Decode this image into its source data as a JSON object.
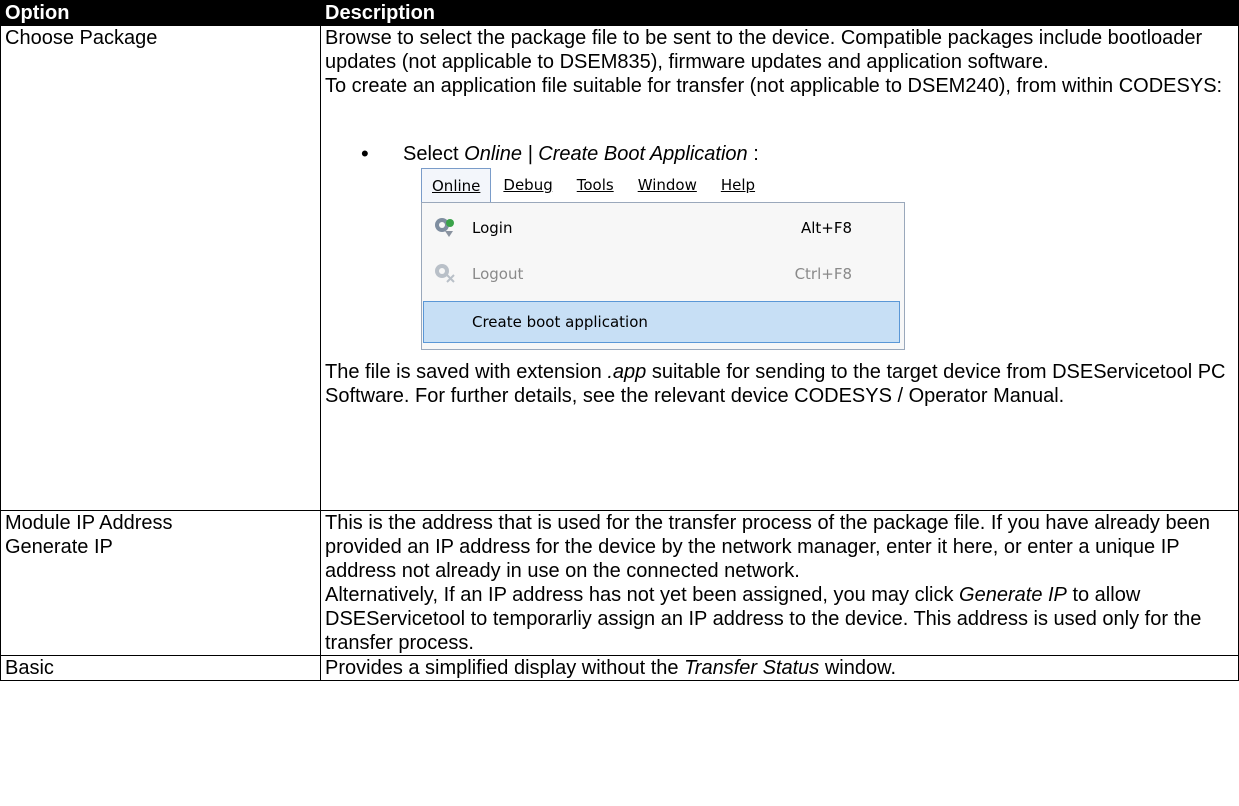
{
  "table": {
    "headers": [
      "Option",
      "Description"
    ],
    "row1": {
      "option": "Choose Package",
      "desc_p1": "Browse to select the package file to be sent to the device. Compatible packages include bootloader updates (not applicable to DSEM835), firmware updates and application software.",
      "desc_p2": "To create an application file suitable for transfer (not applicable to DSEM240), from within CODESYS:",
      "bullet_prefix": "Select ",
      "bullet_italic": "Online | Create Boot Application",
      "bullet_suffix": " :",
      "after_pre": "The file is saved with extension ",
      "after_italic": ".app",
      "after_post": " suitable for sending to the target device from DSEServicetool PC Software. For further details, see the relevant device CODESYS / Operator Manual."
    },
    "row2": {
      "option_line1": "Module IP Address",
      "option_line2": "Generate IP",
      "desc_p1": "This is the address that is used for the transfer process of the package file. If you have already been provided an IP address for the device by the network manager, enter it here, or enter a unique IP address not already in use on the connected network.",
      "desc_p2_pre": "Alternatively, If an IP address has not yet been assigned, you may click ",
      "desc_p2_italic": "Generate IP",
      "desc_p2_post": " to allow DSEServicetool to temporarliy assign an IP address to the device. This address is used only for the transfer process."
    },
    "row3": {
      "option": "Basic",
      "desc_pre": "Provides a simplified display without the ",
      "desc_italic": "Transfer Status",
      "desc_post": " window."
    }
  },
  "menu": {
    "bar": [
      "Online",
      "Debug",
      "Tools",
      "Window",
      "Help"
    ],
    "items": [
      {
        "label": "Login",
        "shortcut": "Alt+F8",
        "icon": "login-gear-icon"
      },
      {
        "label": "Logout",
        "shortcut": "Ctrl+F8",
        "icon": "logout-gear-icon"
      },
      {
        "label": "Create boot application",
        "shortcut": ""
      }
    ]
  }
}
